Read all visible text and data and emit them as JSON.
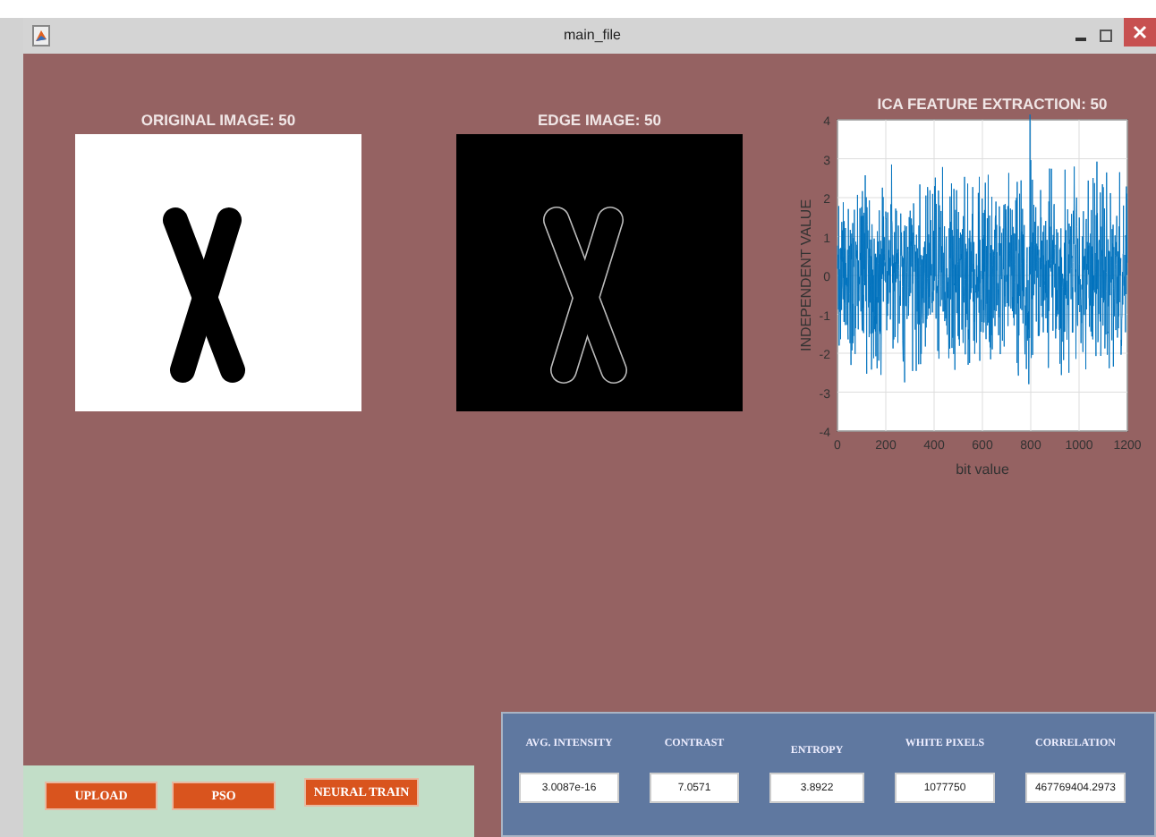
{
  "window": {
    "title": "main_file"
  },
  "figures": [
    {
      "title": "ORIGINAL IMAGE: 50",
      "kind": "original"
    },
    {
      "title": "EDGE IMAGE: 50",
      "kind": "edge"
    }
  ],
  "chart": {
    "title": "ICA FEATURE EXTRACTION: 50",
    "xlabel": "bit value",
    "ylabel": "INDEPENDENT VALUE",
    "xticks": [
      "0",
      "200",
      "400",
      "600",
      "800",
      "1000",
      "1200"
    ],
    "yticks": [
      "4",
      "3",
      "2",
      "1",
      "0",
      "-1",
      "-2",
      "-3",
      "-4"
    ]
  },
  "buttons": [
    {
      "label": "UPLOAD"
    },
    {
      "label": "PSO"
    },
    {
      "label": "NEURAL TRAIN"
    }
  ],
  "metrics": [
    {
      "label": "AVG. INTENSITY",
      "value": "3.0087e-16"
    },
    {
      "label": "CONTRAST",
      "value": "7.0571"
    },
    {
      "label": "ENTROPY",
      "value": "3.8922"
    },
    {
      "label": "WHITE PIXELS",
      "value": "1077750"
    },
    {
      "label": "CORRELATION",
      "value": "467769404.2973"
    }
  ]
}
